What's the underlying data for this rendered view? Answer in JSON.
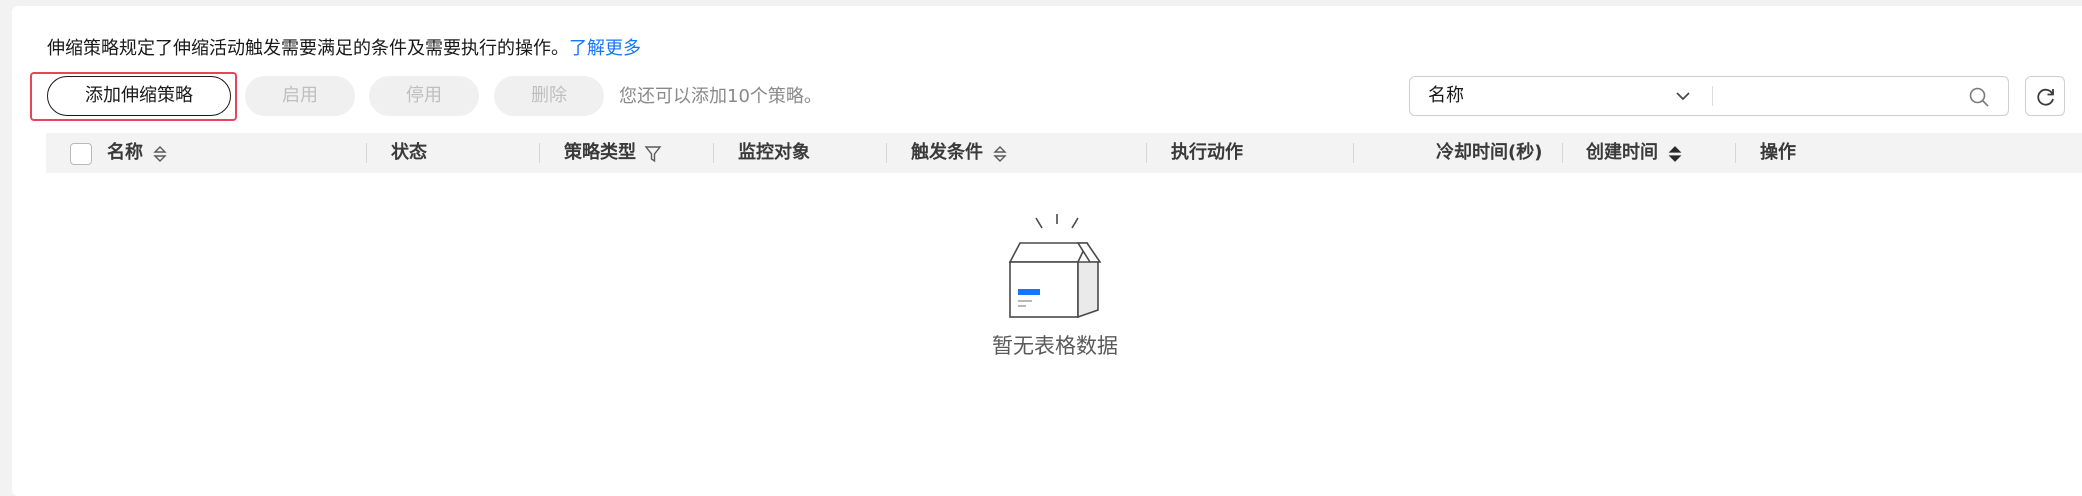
{
  "description": {
    "text": "伸缩策略规定了伸缩活动触发需要满足的条件及需要执行的操作。",
    "link": "了解更多"
  },
  "toolbar": {
    "add_label": "添加伸缩策略",
    "enable_label": "启用",
    "disable_label": "停用",
    "delete_label": "删除",
    "quota_text": "您还可以添加10个策略。"
  },
  "search": {
    "field_value": "名称",
    "input_value": "",
    "input_placeholder": ""
  },
  "table": {
    "columns": [
      {
        "label": "名称"
      },
      {
        "label": "状态"
      },
      {
        "label": "策略类型"
      },
      {
        "label": "监控对象"
      },
      {
        "label": "触发条件"
      },
      {
        "label": "执行动作"
      },
      {
        "label": "冷却时间(秒)"
      },
      {
        "label": "创建时间"
      },
      {
        "label": "操作"
      }
    ],
    "rows": [],
    "empty_text": "暂无表格数据"
  },
  "colors": {
    "link": "#1476ff",
    "highlight_border": "#e8455a",
    "empty_accent": "#1476ff"
  }
}
